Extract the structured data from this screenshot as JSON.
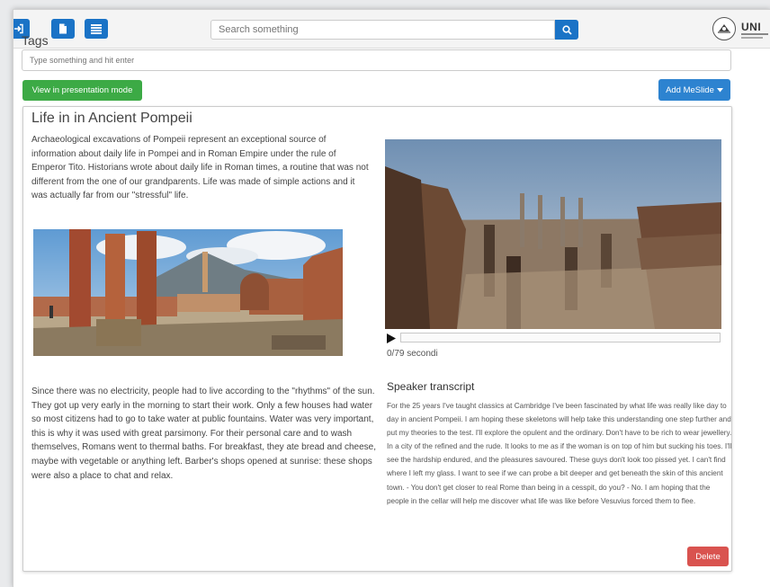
{
  "header": {
    "search": {
      "placeholder": "Search something"
    },
    "logo_text": "UNI",
    "icons": [
      "sign-in-icon",
      "file-icon",
      "list-icon",
      "search-icon"
    ]
  },
  "tags": {
    "label": "Tags",
    "input_placeholder": "Type something and hit enter"
  },
  "actions": {
    "presentation_label": "View in presentation mode",
    "add_meslide_label": "Add MeSlide"
  },
  "slide": {
    "title": "Life in in Ancient Pompeii",
    "paragraph1": "Archaeological excavations of Pompeii represent an exceptional source of information about daily life in Pompei and in Roman Empire under the rule of Emperor Tito. Historians wrote about daily life in Roman times, a routine that was not different from the one of our grandparents. Life was made of simple actions and it was actually far from our \"stressful\" life.",
    "paragraph2": "Since there was no electricity, people had to live according to the \"rhythms\" of the sun. They got up very early in the morning to start their work. Only a few houses had water so most citizens had to go to take water at public fountains. Water was very important, this is why it was used with great parsimony. For their personal care and to wash themselves, Romans went to thermal baths. For breakfast, they ate bread and cheese, maybe with vegetable or anything left. Barber's shops opened at sunrise: these shops were also a place to chat and relax.",
    "video": {
      "time_text": "0/79 secondi",
      "progress": 0
    },
    "transcript_title": "Speaker transcript",
    "transcript": "For the 25 years I've taught classics at Cambridge I've been fascinated by what life was really like day to day in ancient Pompeii. I am hoping these skeletons will help take this understanding one step further and put my theories to the test. I'll explore the opulent and the ordinary. Don't have to be rich to wear jewellery. In a city of the refined and the rude. It looks to me as if the woman is on top of him but sucking his toes. I'll see the hardship endured, and the pleasures savoured. These guys don't look too pissed yet. I can't find where I left my glass. I want to see if we can probe a bit deeper and get beneath the skin of this ancient town. - You don't get closer to real Rome than being in a cesspit, do you? - No. I am hoping that the people in the cellar will help me discover what life was like before Vesuvius forced them to flee.",
    "delete_label": "Delete"
  },
  "colors": {
    "primary": "#1a73c6",
    "success": "#3caa45",
    "info": "#2d83d0",
    "danger": "#d9534f"
  }
}
